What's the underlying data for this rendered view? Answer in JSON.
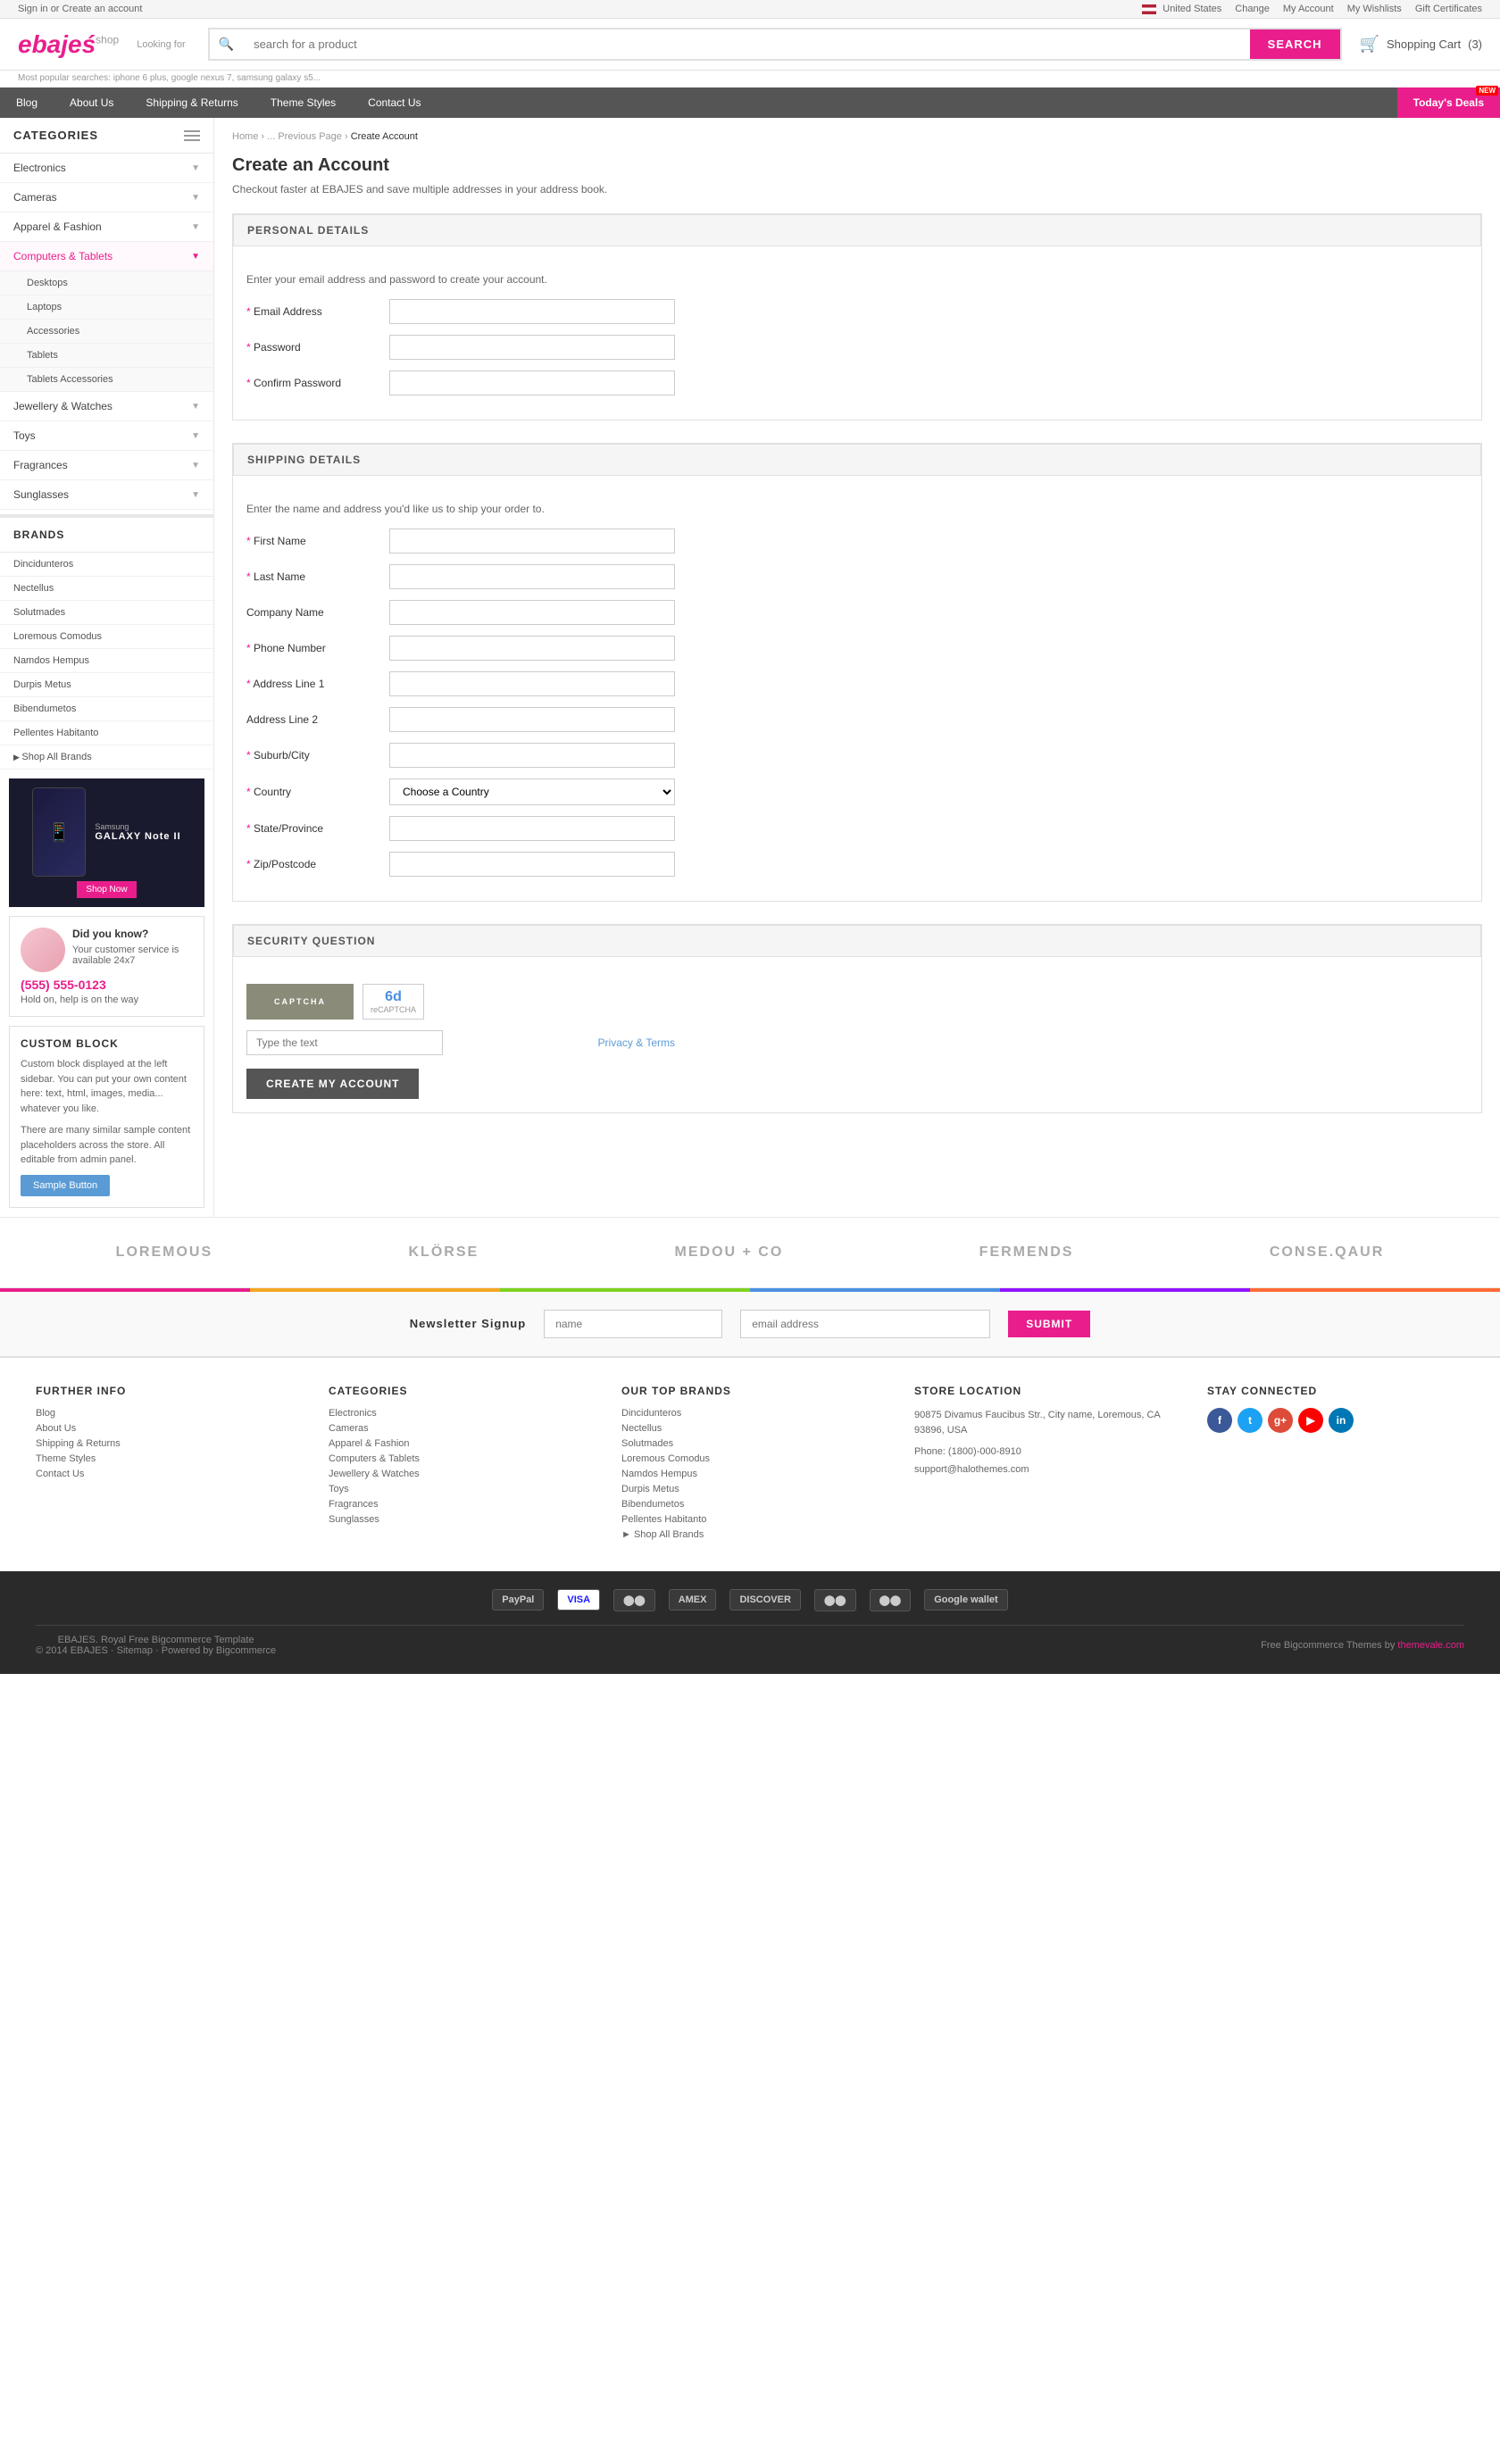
{
  "topbar": {
    "left": "Sign in or Create an account",
    "country": "United States",
    "change": "Change",
    "my_account": "My Account",
    "my_wishlists": "My Wishlists",
    "gift_certificates": "Gift Certificates"
  },
  "header": {
    "logo_text": "ebajeś",
    "logo_shop": "shop",
    "looking_for": "Looking for",
    "search_placeholder": "search for a product",
    "search_btn": "SEARCH",
    "popular": "Most popular searches: iphone 6 plus, google nexus 7, samsung galaxy s5...",
    "cart_label": "Shopping Cart",
    "cart_count": "(3)"
  },
  "nav": {
    "items": [
      {
        "label": "Blog"
      },
      {
        "label": "About Us"
      },
      {
        "label": "Shipping & Returns"
      },
      {
        "label": "Theme Styles"
      },
      {
        "label": "Contact Us"
      }
    ],
    "todays_deals": "Today's Deals",
    "new_badge": "NEW"
  },
  "sidebar": {
    "categories_label": "CATEGORIES",
    "items": [
      {
        "label": "Electronics",
        "has_sub": true
      },
      {
        "label": "Cameras",
        "has_sub": true
      },
      {
        "label": "Apparel & Fashion",
        "has_sub": true
      },
      {
        "label": "Computers & Tablets",
        "has_sub": true,
        "active": true
      },
      {
        "label": "Jewellery & Watches",
        "has_sub": true
      },
      {
        "label": "Toys",
        "has_sub": true
      },
      {
        "label": "Fragrances",
        "has_sub": true
      },
      {
        "label": "Sunglasses",
        "has_sub": true
      }
    ],
    "sub_items": [
      "Desktops",
      "Laptops",
      "Accessories",
      "Tablets",
      "Tablets Accessories"
    ],
    "brands_label": "BRANDS",
    "brands": [
      "Dincidunteros",
      "Nectellus",
      "Solutmades",
      "Loremous Comodus",
      "Namdos Hempus",
      "Durpis Metus",
      "Bibendumetos",
      "Pellentes Habitanto"
    ],
    "shop_all_brands": "Shop All Brands",
    "samsung_title": "Samsung",
    "galaxy_label": "GALAXY Note II",
    "shop_now": "Shop Now",
    "did_you_know": "Did you know?",
    "customer_service": "Your customer service is available 24x7",
    "phone": "(555) 555-0123",
    "hold_on": "Hold on, help is on the way",
    "custom_block_title": "CUSTOM BLOCK",
    "custom_block_text1": "Custom block displayed at the left sidebar. You can put your own content here: text, html, images, media... whatever you like.",
    "custom_block_text2": "There are many similar sample content placeholders across the store. All editable from admin panel.",
    "sample_btn": "Sample Button"
  },
  "breadcrumb": {
    "home": "Home",
    "previous": "... Previous Page",
    "current": "Create Account"
  },
  "create_account": {
    "title": "Create an Account",
    "subtitle": "Checkout faster at EBAJES and save multiple addresses in your address book.",
    "personal_details_header": "PERSONAL DETAILS",
    "personal_details_desc": "Enter your email address and password to create your account.",
    "fields_personal": [
      {
        "label": "Email Address",
        "required": true,
        "type": "email"
      },
      {
        "label": "Password",
        "required": true,
        "type": "password"
      },
      {
        "label": "Confirm Password",
        "required": true,
        "type": "password"
      }
    ],
    "shipping_details_header": "SHIPPING DETAILS",
    "shipping_details_desc": "Enter the name and address you'd like us to ship your order to.",
    "fields_shipping": [
      {
        "label": "First Name",
        "required": true
      },
      {
        "label": "Last Name",
        "required": true
      },
      {
        "label": "Company Name",
        "required": false
      },
      {
        "label": "Phone Number",
        "required": true
      },
      {
        "label": "Address Line 1",
        "required": true
      },
      {
        "label": "Address Line 2",
        "required": false
      },
      {
        "label": "Suburb/City",
        "required": true
      },
      {
        "label": "Country",
        "required": true,
        "type": "select",
        "placeholder": "Choose a Country"
      },
      {
        "label": "State/Province",
        "required": true
      },
      {
        "label": "Zip/Postcode",
        "required": true
      }
    ],
    "security_header": "SECURITY QUESTION",
    "captcha_type_text": "Type the text",
    "privacy_terms": "Privacy & Terms",
    "create_btn": "CREATE MY ACCOUNT"
  },
  "brands_strip": {
    "items": [
      "LOREMOUS",
      "KLÖRSE",
      "MEDOU + CO",
      "FERMENDS",
      "Conse.QauR"
    ]
  },
  "color_bar": {
    "colors": [
      "#e91e8c",
      "#f5a623",
      "#7ed321",
      "#4a90e2",
      "#9013fe",
      "#ff6b35"
    ]
  },
  "newsletter": {
    "label": "Newsletter Signup",
    "name_placeholder": "name",
    "email_placeholder": "email address",
    "btn_label": "SUBMIT"
  },
  "footer": {
    "further_info": {
      "title": "FURTHER INFO",
      "links": [
        "Blog",
        "About Us",
        "Shipping & Returns",
        "Theme Styles",
        "Contact Us"
      ]
    },
    "categories": {
      "title": "CATEGORIES",
      "links": [
        "Electronics",
        "Cameras",
        "Apparel & Fashion",
        "Computers & Tablets",
        "Jewellery & Watches",
        "Toys",
        "Fragrances",
        "Sunglasses"
      ]
    },
    "top_brands": {
      "title": "OUR TOP BRANDS",
      "links": [
        "Dincidunteros",
        "Nectellus",
        "Solutmades",
        "Loremous Comodus",
        "Namdos Hempus",
        "Durpis Metus",
        "Bibendumetos",
        "Pellentes Habitanto",
        "▶ Shop All Brands"
      ]
    },
    "store_location": {
      "title": "STORE LOCATION",
      "address": "90875 Divamus Faucibus Str., City name, Loremous, CA 93896, USA",
      "phone": "Phone: (1800)-000-8910",
      "email": "support@halothemes.com"
    },
    "stay_connected": {
      "title": "STAY CONNECTED",
      "social": [
        "f",
        "t",
        "g+",
        "▶",
        "in"
      ]
    }
  },
  "footer_dark": {
    "payment_methods": [
      "PayPal",
      "VISA",
      "MasterCard",
      "AMEX",
      "DISCOVER",
      "Cirrus",
      "maestro",
      "Google wallet"
    ],
    "copyright": "EBAJES. Royal Free Bigcommerce Template",
    "copyright_year": "© 2014 EBAJES · Sitemap · Powered by Bigcommerce",
    "free_themes": "Free Bigcommerce Themes by",
    "themes_link": "themevale.com"
  }
}
